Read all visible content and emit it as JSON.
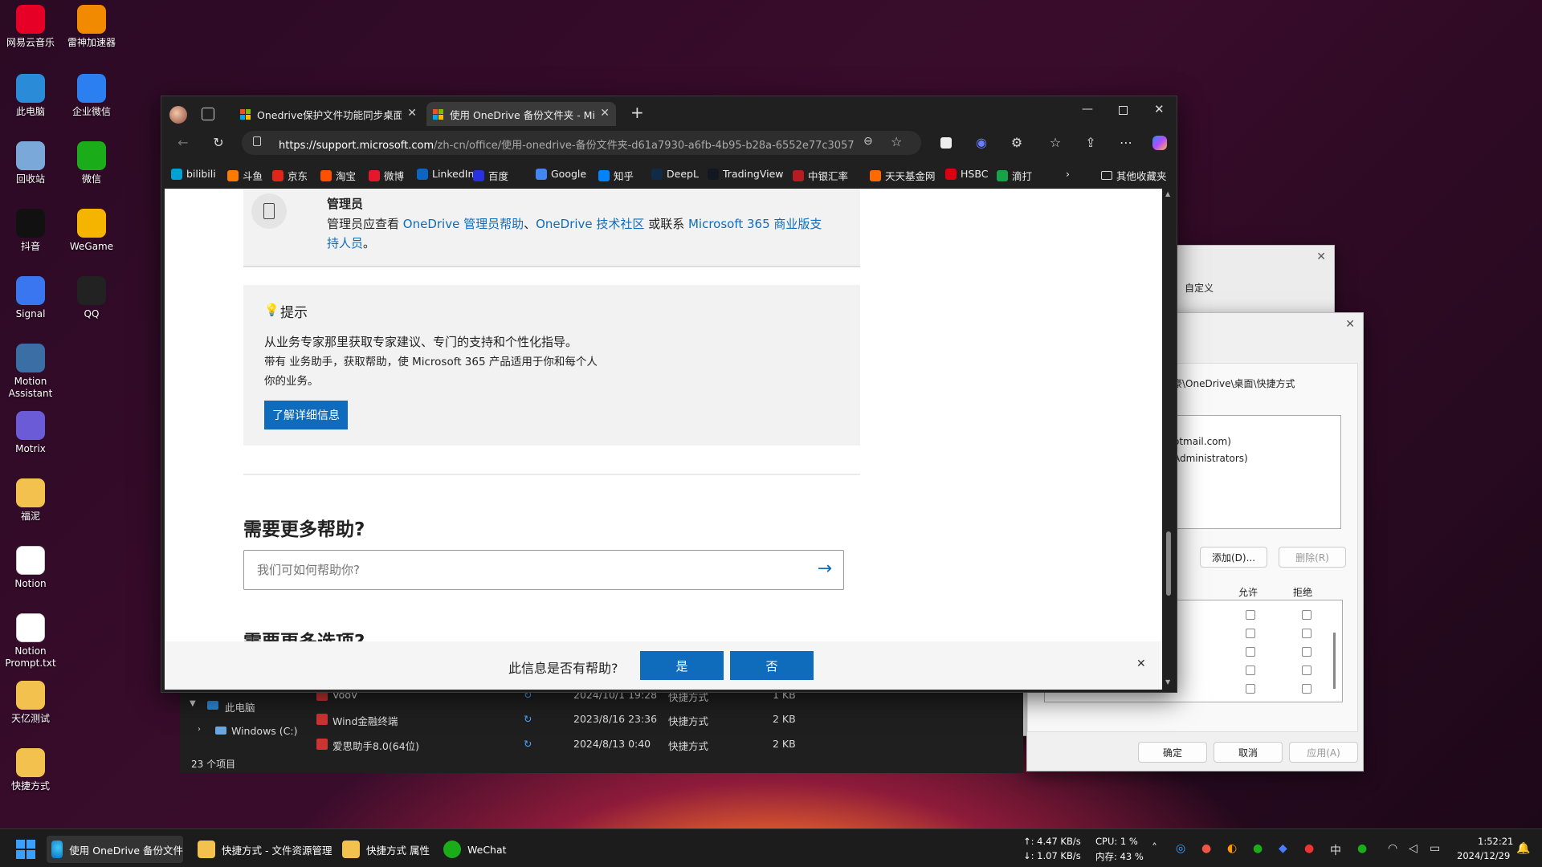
{
  "desktop": {
    "icons": [
      {
        "label": "网易云音乐",
        "icon": "netease-music-icon",
        "color": "#e60026"
      },
      {
        "label": "雷神加速器",
        "icon": "leishen-accelerator-icon",
        "color": "#f28a00"
      },
      {
        "label": "此电脑",
        "icon": "computer-icon",
        "color": "#2a8bd8"
      },
      {
        "label": "企业微信",
        "icon": "wecom-icon",
        "color": "#2b7ff0"
      },
      {
        "label": "回收站",
        "icon": "recycle-bin-icon",
        "color": "#7aa9d9"
      },
      {
        "label": "微信",
        "icon": "wechat-icon",
        "color": "#1aad19"
      },
      {
        "label": "抖音",
        "icon": "douyin-icon",
        "color": "#111111"
      },
      {
        "label": "WeGame",
        "icon": "wegame-icon",
        "color": "#f5b400"
      },
      {
        "label": "Signal",
        "icon": "signal-icon",
        "color": "#3a76f0"
      },
      {
        "label": "QQ",
        "icon": "qq-icon",
        "color": "#222222"
      },
      {
        "label": "Motion Assistant",
        "icon": "motion-assistant-icon",
        "color": "#3a6ea5"
      },
      {
        "label": "Motrix",
        "icon": "motrix-icon",
        "color": "#6b5bd6"
      },
      {
        "label": "福泥",
        "icon": "folder-icon",
        "color": "#f2c14e"
      },
      {
        "label": "Notion",
        "icon": "notion-icon",
        "color": "#ffffff"
      },
      {
        "label": "Notion Prompt.txt",
        "icon": "text-file-icon",
        "color": "#ffffff"
      },
      {
        "label": "天亿测试",
        "icon": "folder-icon",
        "color": "#f2c14e"
      },
      {
        "label": "快捷方式",
        "icon": "folder-icon",
        "color": "#f2c14e"
      }
    ]
  },
  "bg_windows": {
    "custom_tab": "自定义",
    "props_path": "豪\\OneDrive\\桌面\\快捷方式",
    "user1": "otmail.com)",
    "user2": "Administrators)",
    "add_btn": "添加(D)...",
    "remove_btn": "删除(R)",
    "allow": "允许",
    "deny": "拒绝",
    "ok": "确定",
    "cancel": "取消",
    "apply": "应用(A)"
  },
  "explorer": {
    "tree_pc": "此电脑",
    "tree_c": "Windows (C:)",
    "count": "23 个项目",
    "rows": [
      {
        "name": "VooV",
        "date": "2024/10/1 19:28",
        "type": "快捷方式",
        "size": "1 KB"
      },
      {
        "name": "Wind金融终端",
        "date": "2023/8/16 23:36",
        "type": "快捷方式",
        "size": "2 KB"
      },
      {
        "name": "爱思助手8.0(64位)",
        "date": "2024/8/13 0:40",
        "type": "快捷方式",
        "size": "2 KB"
      }
    ]
  },
  "browser": {
    "tabs": [
      {
        "title": "Onedrive保护文件功能同步桌面时"
      },
      {
        "title": "使用 OneDrive 备份文件夹 - Micr"
      }
    ],
    "url_host": "https://support.microsoft.com",
    "url_path": "/zh-cn/office/使用-onedrive-备份文件夹-d61a7930-a6fb-4b95-b28a-6552e77c3057",
    "favorites": [
      {
        "label": "bilibili",
        "color": "#00a1d6"
      },
      {
        "label": "斗鱼",
        "color": "#ff7a00"
      },
      {
        "label": "京东",
        "color": "#e1251b"
      },
      {
        "label": "淘宝",
        "color": "#ff5000"
      },
      {
        "label": "微博",
        "color": "#e6162d"
      },
      {
        "label": "LinkedIn",
        "color": "#0a66c2"
      },
      {
        "label": "百度",
        "color": "#2932e1"
      },
      {
        "label": "Google",
        "color": "#4285f4"
      },
      {
        "label": "知乎",
        "color": "#0084ff"
      },
      {
        "label": "DeepL",
        "color": "#0f2b46"
      },
      {
        "label": "TradingView",
        "color": "#131722"
      },
      {
        "label": "中银汇率",
        "color": "#b81c22"
      },
      {
        "label": "天天基金网",
        "color": "#ff6a00"
      },
      {
        "label": "HSBC",
        "color": "#db0011"
      },
      {
        "label": "滴打",
        "color": "#16a34a"
      }
    ],
    "other_favorites": "其他收藏夹"
  },
  "page": {
    "admin_title": "管理员",
    "admin_line1_pre": "管理员应查看 ",
    "admin_link1": "OneDrive 管理员帮助",
    "admin_sep": "、",
    "admin_link2": "OneDrive 技术社区",
    "admin_mid": " 或联系 ",
    "admin_link3a": "Microsoft 365 商业版支",
    "admin_link3b": "持人员",
    "admin_end": "。",
    "tip_title": "提示",
    "tip_line1": "从业务专家那里获取专家建议、专门的支持和个性化指导。",
    "tip_line2": "带有  业务助手，获取帮助，使 Microsoft 365 产品适用于你和每个人",
    "tip_line3": "你的业务。",
    "tip_button": "了解详细信息",
    "help_heading": "需要更多帮助?",
    "help_placeholder": "我们可如何帮助你?",
    "options_heading": "需要更多选项?",
    "feedback_question": "此信息是否有帮助?",
    "feedback_yes": "是",
    "feedback_no": "否"
  },
  "taskbar": {
    "apps": [
      {
        "label": "使用 OneDrive 备份文件"
      },
      {
        "label": "快捷方式 - 文件资源管理"
      },
      {
        "label": "快捷方式 属性"
      },
      {
        "label": "WeChat"
      }
    ],
    "net_up": "↑: 4.47 KB/s",
    "net_down": "↓: 1.07 KB/s",
    "cpu": "CPU: 1 %",
    "mem": "内存: 43 %",
    "ime": "中",
    "time": "1:52:21",
    "date": "2024/12/29"
  }
}
